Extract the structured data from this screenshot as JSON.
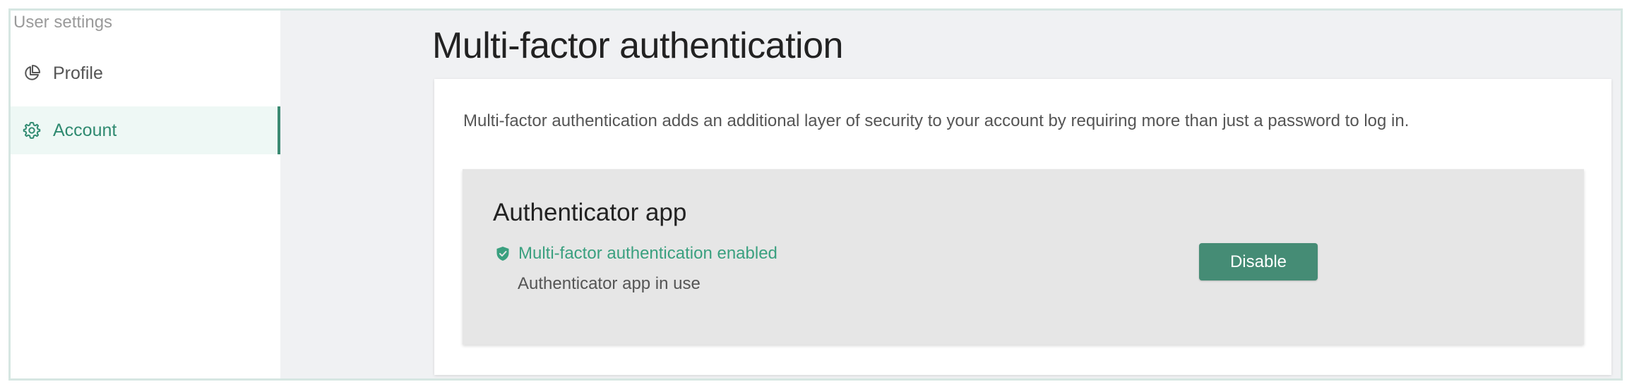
{
  "sidebar": {
    "heading": "User settings",
    "items": [
      {
        "label": "Profile",
        "icon": "pie-chart-icon",
        "active": false
      },
      {
        "label": "Account",
        "icon": "gear-icon",
        "active": true
      }
    ]
  },
  "main": {
    "title": "Multi-factor authentication",
    "description": "Multi-factor authentication adds an additional layer of security to your account by requiring more than just a password to log in.",
    "authenticator": {
      "title": "Authenticator app",
      "status": "Multi-factor authentication enabled",
      "status_icon": "shield-check-icon",
      "sub_status": "Authenticator app in use",
      "disable_label": "Disable"
    }
  },
  "colors": {
    "accent": "#458c75",
    "accent_text": "#3aa07f",
    "active_bg": "#eef8f5",
    "page_bg": "#f0f1f3",
    "inner_card_bg": "#e6e6e6"
  }
}
